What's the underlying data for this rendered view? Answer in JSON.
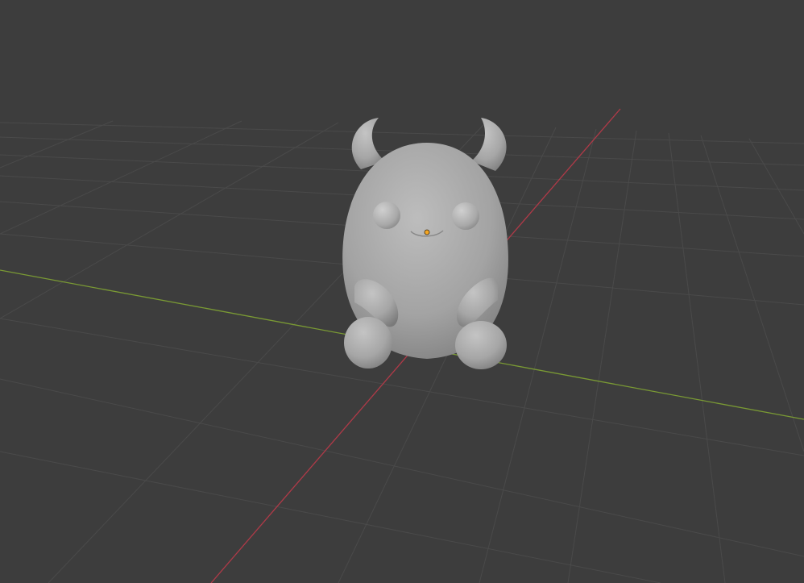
{
  "viewport": {
    "background": "#3d3d3d",
    "grid_color": "#4a4a4a",
    "x_axis_color": "#b03a48",
    "y_axis_color": "#7a9a34",
    "origin_color": "#f5a623",
    "model_color": "#a5a5a5"
  },
  "scene": {
    "object": "monster-figurine-mesh",
    "object_selected_origin": true
  }
}
